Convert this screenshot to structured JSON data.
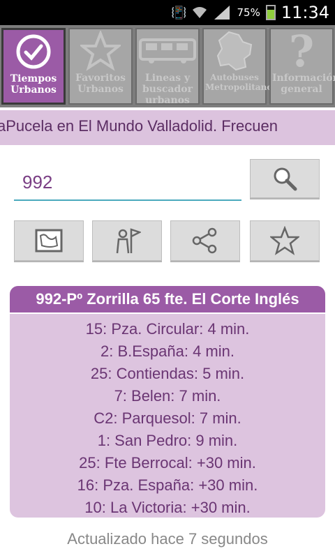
{
  "status": {
    "battery_pct": "75%",
    "battery_level": 0.75,
    "clock": "11:34"
  },
  "tabs": [
    {
      "label": "Tiempos Urbanos",
      "icon": "check-circle-icon",
      "active": true
    },
    {
      "label": "Favoritos Urbanos",
      "icon": "star-icon",
      "active": false
    },
    {
      "label": "Lineas y buscador urbanos",
      "icon": "bus-icon",
      "active": false
    },
    {
      "label": "Autobuses Metropolitanos",
      "icon": "map-icon",
      "active": false
    },
    {
      "label": "Información general",
      "icon": "question-icon",
      "active": false
    }
  ],
  "ticker": "aPucela en El Mundo Valladolid. Frecuen",
  "search": {
    "value": "992"
  },
  "actions": [
    "map-icon",
    "person-flag-icon",
    "share-icon",
    "star-icon"
  ],
  "stop": {
    "title": "992-Pº Zorrilla 65 fte. El Corte Inglés",
    "arrivals": [
      "15: Pza. Circular: 4 min.",
      "2: B.España: 4 min.",
      "25: Contiendas: 5 min.",
      "7: Belen: 7 min.",
      "C2: Parquesol: 7 min.",
      "1: San Pedro: 9 min.",
      "25: Fte Berrocal: +30 min.",
      "16: Pza. España: +30 min.",
      "10: La Victoria: +30 min."
    ]
  },
  "updated": "Actualizado hace 7 segundos",
  "colors": {
    "accent": "#9b5ba6",
    "card_bg": "#ddc4df",
    "text": "#6a3573"
  }
}
